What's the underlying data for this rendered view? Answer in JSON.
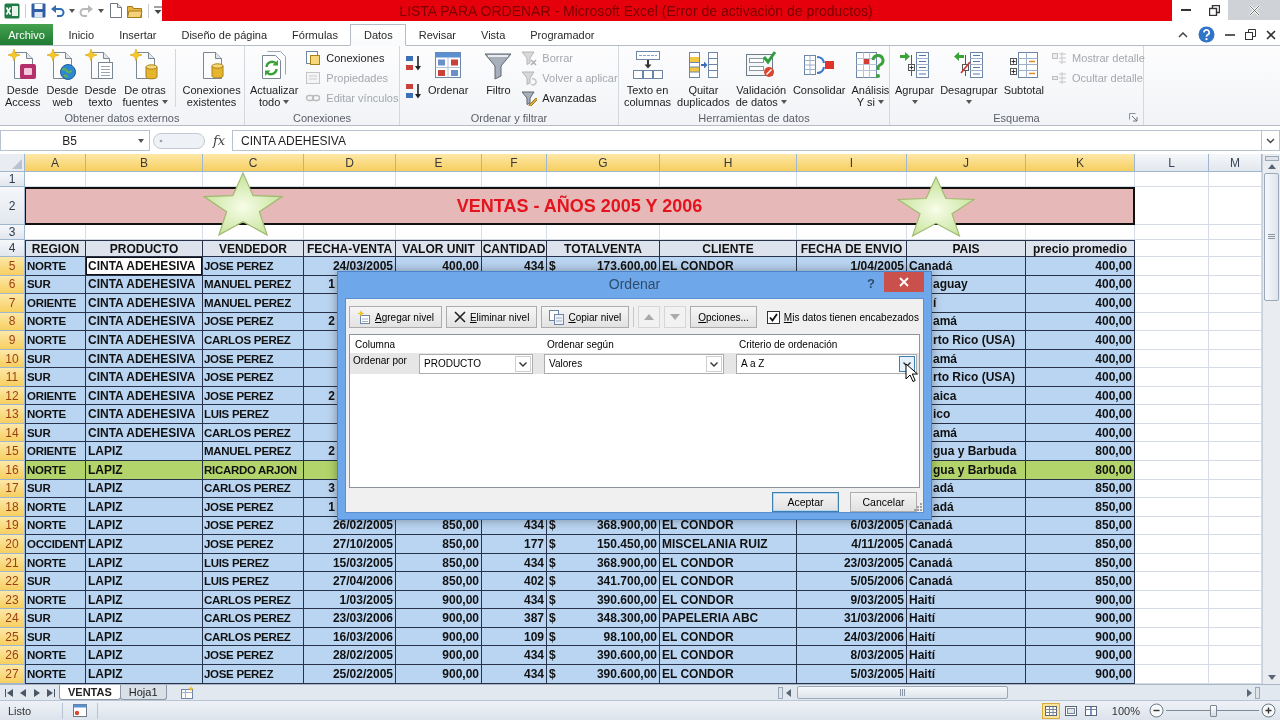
{
  "title_bar": {
    "title": "LISTA PARA ORDENAR - Microsoft Excel (Error de activación de productos)"
  },
  "ribbon_tabs": [
    {
      "label": "Archivo",
      "kind": "file",
      "selected": false
    },
    {
      "label": "Inicio",
      "kind": "tab",
      "selected": false
    },
    {
      "label": "Insertar",
      "kind": "tab",
      "selected": false
    },
    {
      "label": "Diseño de página",
      "kind": "tab",
      "selected": false
    },
    {
      "label": "Fórmulas",
      "kind": "tab",
      "selected": false
    },
    {
      "label": "Datos",
      "kind": "tab",
      "selected": true
    },
    {
      "label": "Revisar",
      "kind": "tab",
      "selected": false
    },
    {
      "label": "Vista",
      "kind": "tab",
      "selected": false
    },
    {
      "label": "Programador",
      "kind": "tab",
      "selected": false
    }
  ],
  "ribbon_groups": [
    {
      "label": "Obtener datos externos",
      "launcher": false,
      "items": [
        {
          "kind": "large",
          "lines": [
            "Desde",
            "Access"
          ],
          "menu": false
        },
        {
          "kind": "large",
          "lines": [
            "Desde",
            "web"
          ],
          "menu": false
        },
        {
          "kind": "large",
          "lines": [
            "Desde",
            "texto"
          ],
          "menu": false
        },
        {
          "kind": "large",
          "lines": [
            "De otras",
            "fuentes"
          ],
          "menu": true
        },
        {
          "kind": "separator"
        },
        {
          "kind": "large",
          "lines": [
            "Conexiones",
            "existentes"
          ],
          "menu": false
        }
      ]
    },
    {
      "label": "Conexiones",
      "launcher": false,
      "items": [
        {
          "kind": "large",
          "lines": [
            "Actualizar",
            "todo"
          ],
          "menu": true
        },
        {
          "kind": "stack",
          "buttons": [
            {
              "label": "Conexiones",
              "disabled": false
            },
            {
              "label": "Propiedades",
              "disabled": true
            },
            {
              "label": "Editar vínculos",
              "disabled": true
            }
          ]
        }
      ]
    },
    {
      "label": "Ordenar y filtrar",
      "launcher": false,
      "items": [
        {
          "kind": "icon_stack",
          "buttons": [
            {
              "disabled": false
            },
            {
              "disabled": false
            }
          ]
        },
        {
          "kind": "large",
          "lines": [
            "Ordenar"
          ],
          "menu": false
        },
        {
          "kind": "separator"
        },
        {
          "kind": "large",
          "lines": [
            "Filtro"
          ],
          "menu": false
        },
        {
          "kind": "stack",
          "buttons": [
            {
              "label": "Borrar",
              "disabled": true
            },
            {
              "label": "Volver a aplicar",
              "disabled": true
            },
            {
              "label": "Avanzadas",
              "disabled": false
            }
          ]
        }
      ]
    },
    {
      "label": "Herramientas de datos",
      "launcher": false,
      "items": [
        {
          "kind": "large",
          "lines": [
            "Texto en",
            "columnas"
          ],
          "menu": false
        },
        {
          "kind": "large",
          "lines": [
            "Quitar",
            "duplicados"
          ],
          "menu": false
        },
        {
          "kind": "large",
          "lines": [
            "Validación",
            "de datos"
          ],
          "menu": true
        },
        {
          "kind": "large",
          "lines": [
            "Consolidar"
          ],
          "menu": false
        },
        {
          "kind": "large",
          "lines": [
            "Análisis",
            "Y si"
          ],
          "menu": true
        }
      ]
    },
    {
      "label": "Esquema",
      "launcher": true,
      "items": [
        {
          "kind": "large",
          "lines": [
            "Agrupar"
          ],
          "menu": true
        },
        {
          "kind": "large",
          "lines": [
            "Desagrupar"
          ],
          "menu": true
        },
        {
          "kind": "large",
          "lines": [
            "Subtotal"
          ],
          "menu": false
        },
        {
          "kind": "stack",
          "buttons": [
            {
              "label": "Mostrar detalle",
              "disabled": true
            },
            {
              "label": "Ocultar detalle",
              "disabled": true
            }
          ]
        }
      ]
    }
  ],
  "formula_bar": {
    "name_box": "B5",
    "function_button": "fx",
    "formula": "CINTA ADEHESIVA"
  },
  "sheet": {
    "columns": [
      {
        "letter": "A",
        "selected": true,
        "active": false
      },
      {
        "letter": "B",
        "selected": true,
        "active": true
      },
      {
        "letter": "C",
        "selected": true,
        "active": false
      },
      {
        "letter": "D",
        "selected": true,
        "active": false
      },
      {
        "letter": "E",
        "selected": true,
        "active": false
      },
      {
        "letter": "F",
        "selected": true,
        "active": false
      },
      {
        "letter": "G",
        "selected": true,
        "active": false
      },
      {
        "letter": "H",
        "selected": true,
        "active": false
      },
      {
        "letter": "I",
        "selected": true,
        "active": false
      },
      {
        "letter": "J",
        "selected": true,
        "active": false
      },
      {
        "letter": "K",
        "selected": true,
        "active": false
      },
      {
        "letter": "L",
        "selected": false,
        "active": false
      },
      {
        "letter": "M",
        "selected": false,
        "active": false
      }
    ],
    "top_rows": [
      {
        "kind": "blank",
        "number": "1"
      },
      {
        "kind": "title",
        "number": "2",
        "text": "VENTAS - AÑOS 2005 Y 2006"
      },
      {
        "kind": "blank",
        "number": "3"
      },
      {
        "kind": "header",
        "number": "4",
        "cells": [
          "REGION",
          "PRODUCTO",
          "VENDEDOR",
          "FECHA-VENTA",
          "VALOR UNIT",
          "CANTIDAD",
          "TOTALVENTA",
          "CLIENTE",
          "FECHA DE ENVIO",
          "PAIS",
          "precio promedio"
        ]
      }
    ],
    "data_rows": [
      {
        "number": "5",
        "selected": true,
        "active": true,
        "highlighted": false,
        "covered": false,
        "cells": [
          "NORTE",
          "CINTA ADEHESIVA",
          "JOSE PEREZ",
          "24/03/2005",
          "400,00",
          "434",
          "$",
          "173.600,00",
          "EL CONDOR",
          "1/04/2005",
          "Canadá",
          "400,00"
        ]
      },
      {
        "number": "6",
        "selected": true,
        "active": false,
        "highlighted": false,
        "covered": true,
        "cells": [
          "SUR",
          "CINTA ADEHESIVA",
          "MANUEL PEREZ",
          "1",
          null,
          null,
          null,
          null,
          null,
          null,
          "aguay",
          "400,00"
        ]
      },
      {
        "number": "7",
        "selected": true,
        "active": false,
        "highlighted": false,
        "covered": true,
        "cells": [
          "ORIENTE",
          "CINTA ADEHESIVA",
          "MANUEL PEREZ",
          null,
          null,
          null,
          null,
          null,
          null,
          null,
          "í",
          "400,00"
        ]
      },
      {
        "number": "8",
        "selected": true,
        "active": false,
        "highlighted": false,
        "covered": true,
        "cells": [
          "NORTE",
          "CINTA ADEHESIVA",
          "JOSE PEREZ",
          "2",
          null,
          null,
          null,
          null,
          null,
          null,
          "amá",
          "400,00"
        ]
      },
      {
        "number": "9",
        "selected": true,
        "active": false,
        "highlighted": false,
        "covered": true,
        "cells": [
          "NORTE",
          "CINTA ADEHESIVA",
          "CARLOS PEREZ",
          null,
          null,
          null,
          null,
          null,
          null,
          null,
          "rto Rico (USA)",
          "400,00"
        ]
      },
      {
        "number": "10",
        "selected": true,
        "active": false,
        "highlighted": false,
        "covered": true,
        "cells": [
          "SUR",
          "CINTA ADEHESIVA",
          "JOSE PEREZ",
          null,
          null,
          null,
          null,
          null,
          null,
          null,
          "amá",
          "400,00"
        ]
      },
      {
        "number": "11",
        "selected": true,
        "active": false,
        "highlighted": false,
        "covered": true,
        "cells": [
          "SUR",
          "CINTA ADEHESIVA",
          "JOSE PEREZ",
          null,
          null,
          null,
          null,
          null,
          null,
          null,
          "rto Rico (USA)",
          "400,00"
        ]
      },
      {
        "number": "12",
        "selected": true,
        "active": false,
        "highlighted": false,
        "covered": true,
        "cells": [
          "ORIENTE",
          "CINTA ADEHESIVA",
          "JOSE PEREZ",
          "2",
          null,
          null,
          null,
          null,
          null,
          null,
          "aica",
          "400,00"
        ]
      },
      {
        "number": "13",
        "selected": true,
        "active": false,
        "highlighted": false,
        "covered": true,
        "cells": [
          "NORTE",
          "CINTA ADEHESIVA",
          "LUIS PEREZ",
          null,
          null,
          null,
          null,
          null,
          null,
          null,
          "ico",
          "400,00"
        ]
      },
      {
        "number": "14",
        "selected": true,
        "active": false,
        "highlighted": false,
        "covered": true,
        "cells": [
          "SUR",
          "CINTA ADEHESIVA",
          "CARLOS PEREZ",
          null,
          null,
          null,
          null,
          null,
          null,
          null,
          "amá",
          "400,00"
        ]
      },
      {
        "number": "15",
        "selected": true,
        "active": false,
        "highlighted": false,
        "covered": true,
        "cells": [
          "ORIENTE",
          "LAPIZ",
          "MANUEL PEREZ",
          "2",
          null,
          null,
          null,
          null,
          null,
          null,
          "gua y Barbuda",
          "800,00"
        ]
      },
      {
        "number": "16",
        "selected": true,
        "active": false,
        "highlighted": true,
        "covered": true,
        "cells": [
          "NORTE",
          "LAPIZ",
          "RICARDO ARJON",
          null,
          null,
          null,
          null,
          null,
          null,
          null,
          "gua y Barbuda",
          "800,00"
        ]
      },
      {
        "number": "17",
        "selected": true,
        "active": false,
        "highlighted": false,
        "covered": true,
        "cells": [
          "SUR",
          "LAPIZ",
          "CARLOS PEREZ",
          "3",
          null,
          null,
          null,
          null,
          null,
          null,
          "adá",
          "850,00"
        ]
      },
      {
        "number": "18",
        "selected": true,
        "active": false,
        "highlighted": false,
        "covered": true,
        "cells": [
          "NORTE",
          "LAPIZ",
          "JOSE PEREZ",
          "1",
          null,
          null,
          null,
          null,
          null,
          null,
          "adá",
          "850,00"
        ]
      },
      {
        "number": "19",
        "selected": true,
        "active": false,
        "highlighted": false,
        "covered": false,
        "cells": [
          "NORTE",
          "LAPIZ",
          "JOSE PEREZ",
          "26/02/2005",
          "850,00",
          "434",
          "$",
          "368.900,00",
          "EL CONDOR",
          "6/03/2005",
          "Canadá",
          "850,00"
        ]
      },
      {
        "number": "20",
        "selected": true,
        "active": false,
        "highlighted": false,
        "covered": false,
        "cells": [
          "OCCIDENT",
          "LAPIZ",
          "JOSE PEREZ",
          "27/10/2005",
          "850,00",
          "177",
          "$",
          "150.450,00",
          "MISCELANIA RUIZ",
          "4/11/2005",
          "Canadá",
          "850,00"
        ]
      },
      {
        "number": "21",
        "selected": true,
        "active": false,
        "highlighted": false,
        "covered": false,
        "cells": [
          "NORTE",
          "LAPIZ",
          "LUIS PEREZ",
          "15/03/2005",
          "850,00",
          "434",
          "$",
          "368.900,00",
          "EL CONDOR",
          "23/03/2005",
          "Canadá",
          "850,00"
        ]
      },
      {
        "number": "22",
        "selected": true,
        "active": false,
        "highlighted": false,
        "covered": false,
        "cells": [
          "SUR",
          "LAPIZ",
          "LUIS PEREZ",
          "27/04/2006",
          "850,00",
          "402",
          "$",
          "341.700,00",
          "EL CONDOR",
          "5/05/2006",
          "Canadá",
          "850,00"
        ]
      },
      {
        "number": "23",
        "selected": true,
        "active": false,
        "highlighted": false,
        "covered": false,
        "cells": [
          "NORTE",
          "LAPIZ",
          "CARLOS PEREZ",
          "1/03/2005",
          "900,00",
          "434",
          "$",
          "390.600,00",
          "EL CONDOR",
          "9/03/2005",
          "Haití",
          "900,00"
        ]
      },
      {
        "number": "24",
        "selected": true,
        "active": false,
        "highlighted": false,
        "covered": false,
        "cells": [
          "SUR",
          "LAPIZ",
          "CARLOS PEREZ",
          "23/03/2006",
          "900,00",
          "387",
          "$",
          "348.300,00",
          "PAPELERIA ABC",
          "31/03/2006",
          "Haití",
          "900,00"
        ]
      },
      {
        "number": "25",
        "selected": true,
        "active": false,
        "highlighted": false,
        "covered": false,
        "cells": [
          "SUR",
          "LAPIZ",
          "CARLOS PEREZ",
          "16/03/2006",
          "900,00",
          "109",
          "$",
          "98.100,00",
          "EL CONDOR",
          "24/03/2006",
          "Haití",
          "900,00"
        ]
      },
      {
        "number": "26",
        "selected": true,
        "active": false,
        "highlighted": false,
        "covered": false,
        "cells": [
          "NORTE",
          "LAPIZ",
          "JOSE PEREZ",
          "28/02/2005",
          "900,00",
          "434",
          "$",
          "390.600,00",
          "EL CONDOR",
          "8/03/2005",
          "Haití",
          "900,00"
        ]
      },
      {
        "number": "27",
        "selected": true,
        "active": false,
        "highlighted": false,
        "covered": false,
        "cells": [
          "NORTE",
          "LAPIZ",
          "JOSE PEREZ",
          "25/02/2005",
          "900,00",
          "434",
          "$",
          "390.600,00",
          "EL CONDOR",
          "5/03/2005",
          "Haití",
          "900,00"
        ]
      }
    ]
  },
  "dialog": {
    "title": "Ordenar",
    "help": "?",
    "toolbar": [
      {
        "kind": "add",
        "label": "Agregar nivel",
        "disabled": false
      },
      {
        "kind": "delete",
        "label": "Eliminar nivel",
        "disabled": false
      },
      {
        "kind": "copy",
        "label": "Copiar nivel",
        "disabled": false
      },
      {
        "kind": "move_up",
        "disabled": true
      },
      {
        "kind": "move_down",
        "disabled": true
      },
      {
        "kind": "options",
        "label": "Opciones...",
        "disabled": false
      }
    ],
    "headers_checkbox": {
      "label": "Mis datos tienen encabezados",
      "checked": true
    },
    "list_headers": [
      "Columna",
      "Ordenar según",
      "Criterio de ordenación"
    ],
    "levels": [
      {
        "label": "Ordenar por",
        "column": "PRODUCTO",
        "sort_on": "Valores",
        "order": "A a Z",
        "selected": true
      }
    ],
    "buttons": [
      {
        "label": "Aceptar",
        "default": true
      },
      {
        "label": "Cancelar",
        "default": false
      }
    ]
  },
  "sheet_tabs": [
    {
      "label": "VENTAS",
      "selected": true
    },
    {
      "label": "Hoja1",
      "selected": false
    }
  ],
  "status_bar": {
    "status": "Listo",
    "views": [
      {
        "kind": "normal",
        "selected": true
      },
      {
        "kind": "page_layout",
        "selected": false
      },
      {
        "kind": "page_break",
        "selected": false
      }
    ],
    "zoom": "100%",
    "zoom_slider": {
      "level": 0.5
    }
  }
}
